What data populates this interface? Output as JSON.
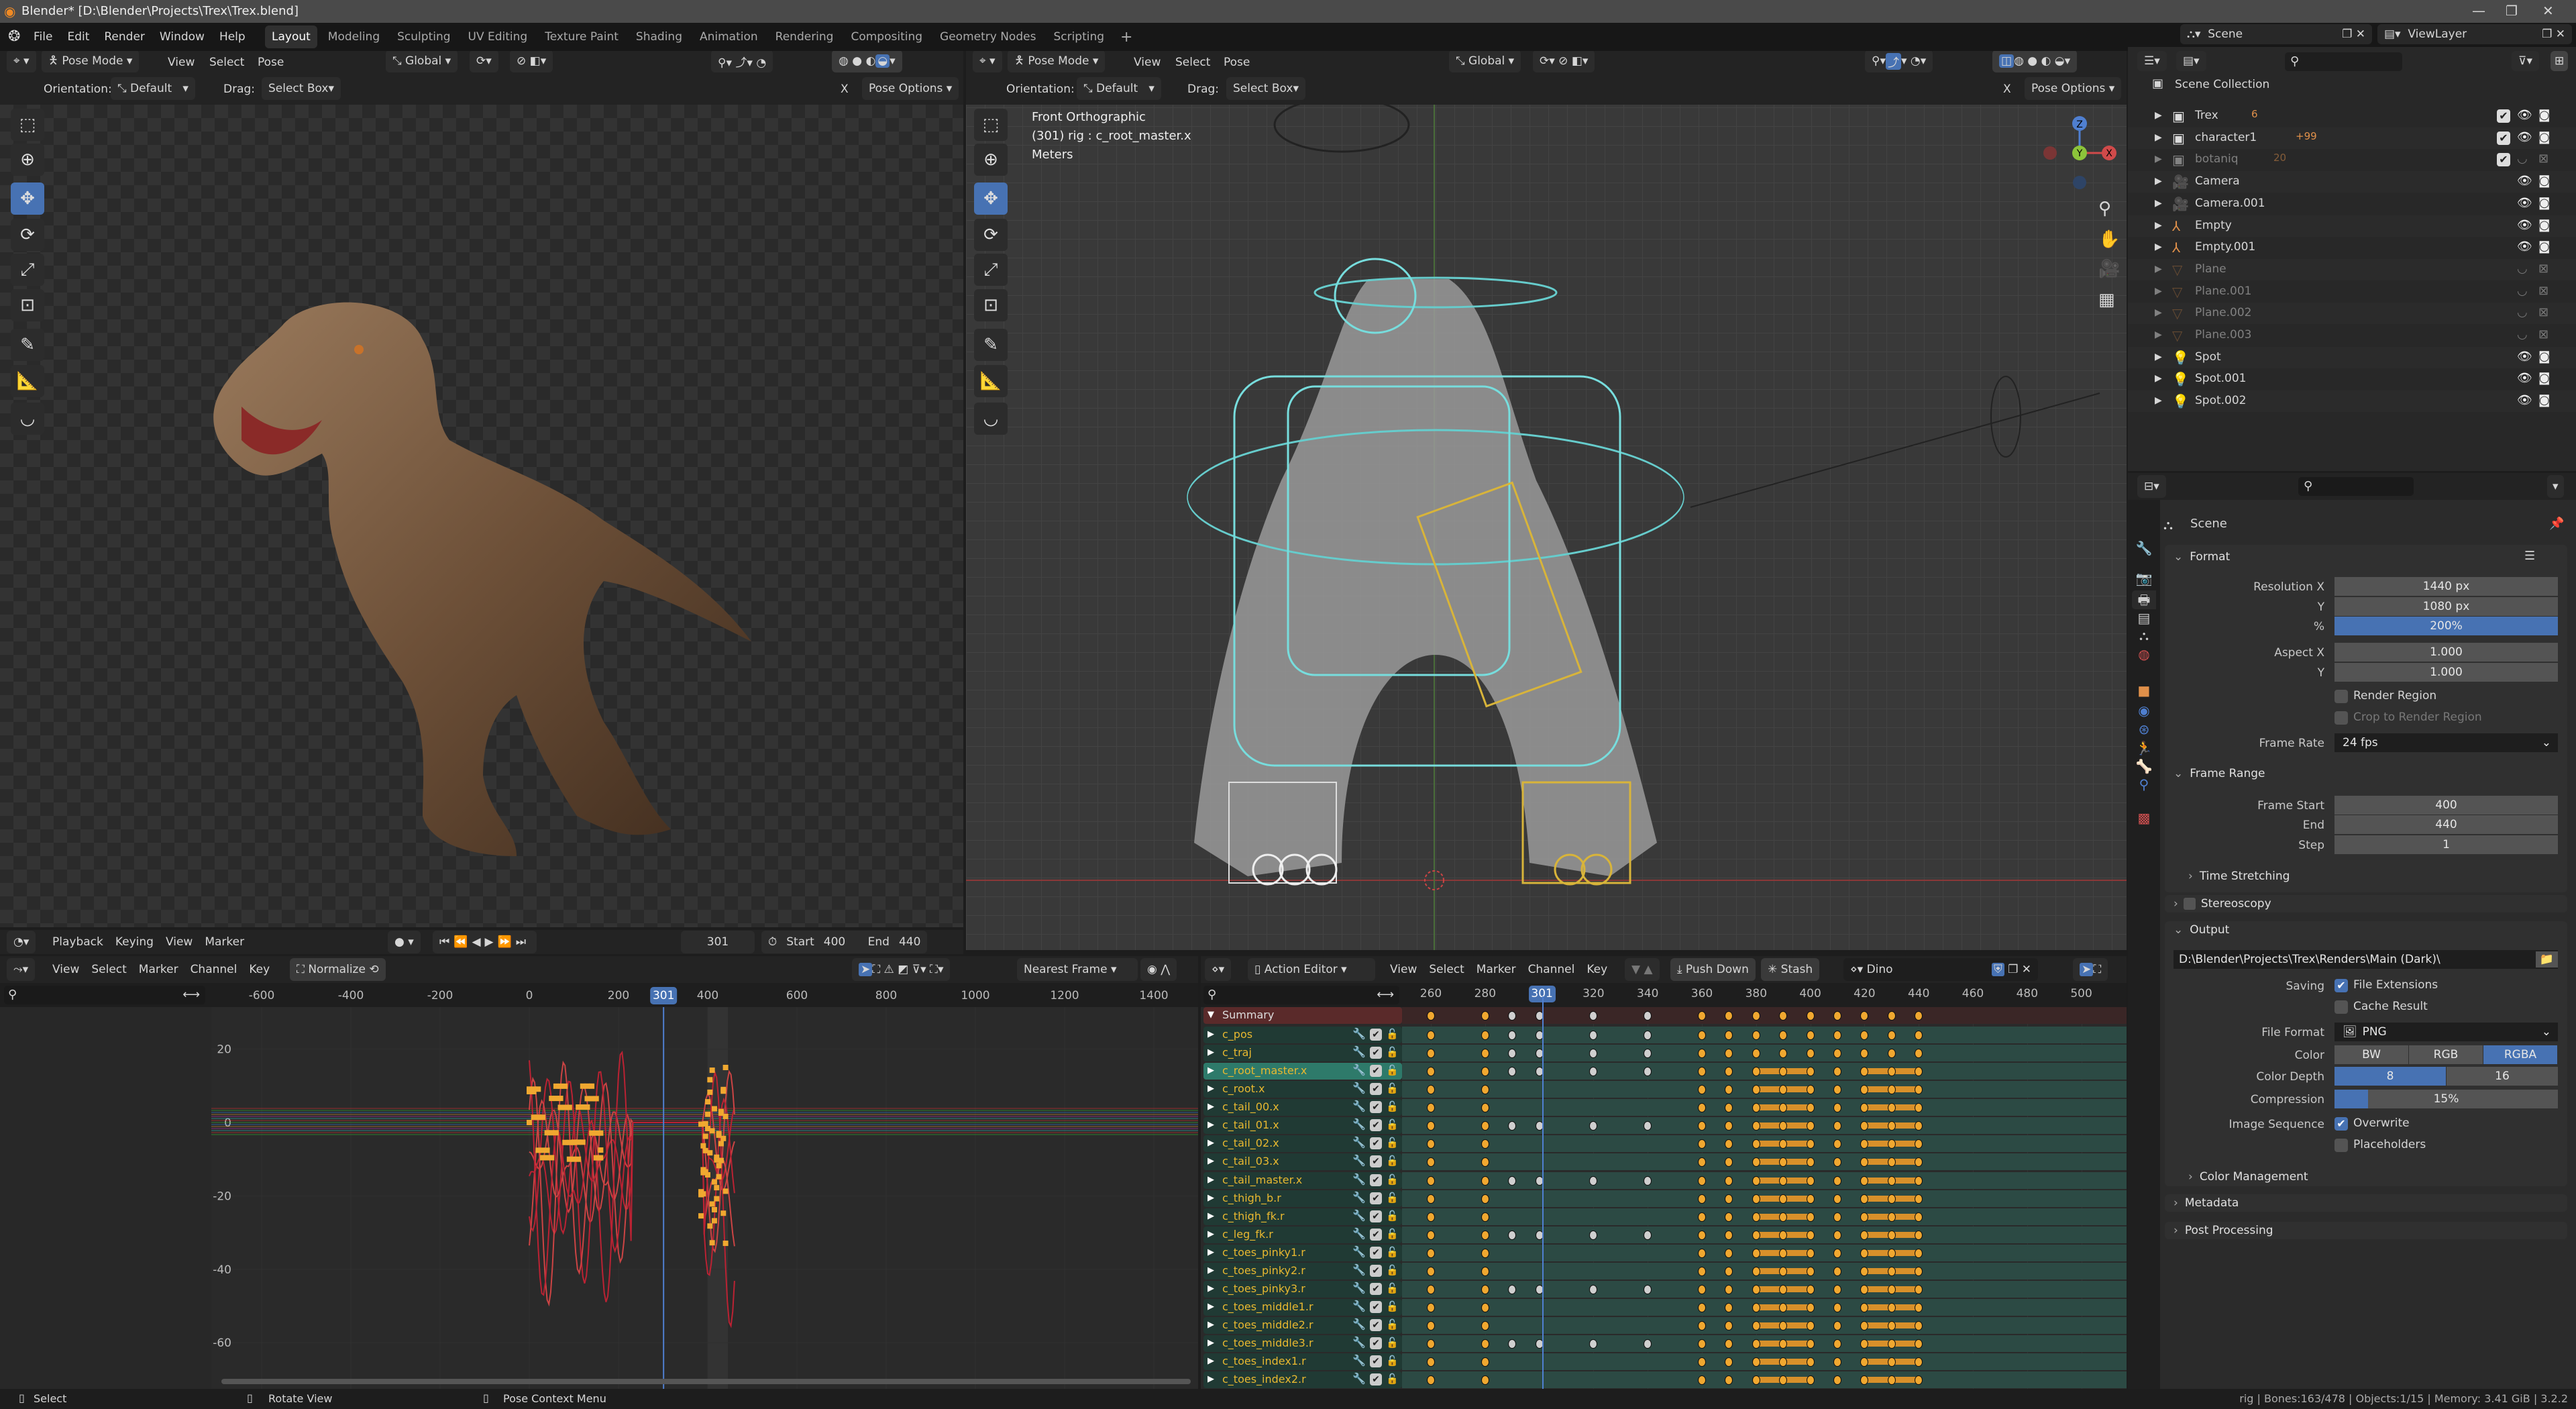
{
  "title_bar": {
    "title": "Blender* [D:\\Blender\\Projects\\Trex\\Trex.blend]"
  },
  "menu": [
    "File",
    "Edit",
    "Render",
    "Window",
    "Help"
  ],
  "workspaces": [
    "Layout",
    "Modeling",
    "Sculpting",
    "UV Editing",
    "Texture Paint",
    "Shading",
    "Animation",
    "Rendering",
    "Compositing",
    "Geometry Nodes",
    "Scripting"
  ],
  "workspace_active": "Layout",
  "viewport_left": {
    "mode": "Pose Mode",
    "menus": [
      "View",
      "Select",
      "Pose"
    ],
    "transform": "Global",
    "orientation_label": "Orientation:",
    "orientation": "Default",
    "drag_label": "Drag:",
    "drag": "Select Box",
    "pose_options": "Pose Options",
    "x_label": "X"
  },
  "viewport_right": {
    "mode": "Pose Mode",
    "menus": [
      "View",
      "Select",
      "Pose"
    ],
    "transform": "Global",
    "orientation_label": "Orientation:",
    "orientation": "Default",
    "drag_label": "Drag:",
    "drag": "Select Box",
    "pose_options": "Pose Options",
    "x_label": "X",
    "overlay": [
      "Front Orthographic",
      "(301) rig : c_root_master.x",
      "Meters"
    ],
    "gizmo": {
      "x": "X",
      "y": "Y",
      "z": "Z"
    }
  },
  "outliner": {
    "scene": "Scene",
    "view_layer": "ViewLayer",
    "root": "Scene Collection",
    "items": [
      {
        "name": "Trex",
        "icon": "collection",
        "badge": "6",
        "check": true,
        "dim": false
      },
      {
        "name": "character1",
        "icon": "collection",
        "badge": "+99",
        "check": true,
        "dim": false
      },
      {
        "name": "botaniq",
        "icon": "collection",
        "badge": "20",
        "check": true,
        "dim": true
      },
      {
        "name": "Camera",
        "icon": "camera",
        "badge": "",
        "check": false,
        "dim": false
      },
      {
        "name": "Camera.001",
        "icon": "camera",
        "badge": "",
        "check": false,
        "dim": false
      },
      {
        "name": "Empty",
        "icon": "empty",
        "badge": "",
        "check": false,
        "dim": false
      },
      {
        "name": "Empty.001",
        "icon": "empty",
        "badge": "",
        "check": false,
        "dim": false
      },
      {
        "name": "Plane",
        "icon": "mesh",
        "badge": "",
        "check": false,
        "dim": true
      },
      {
        "name": "Plane.001",
        "icon": "mesh",
        "badge": "",
        "check": false,
        "dim": true
      },
      {
        "name": "Plane.002",
        "icon": "mesh",
        "badge": "",
        "check": false,
        "dim": true
      },
      {
        "name": "Plane.003",
        "icon": "mesh",
        "badge": "",
        "check": false,
        "dim": true
      },
      {
        "name": "Spot",
        "icon": "light",
        "badge": "",
        "check": false,
        "dim": false
      },
      {
        "name": "Spot.001",
        "icon": "light",
        "badge": "",
        "check": false,
        "dim": false
      },
      {
        "name": "Spot.002",
        "icon": "light",
        "badge": "",
        "check": false,
        "dim": false
      }
    ]
  },
  "properties": {
    "context": "Scene",
    "format": {
      "title": "Format",
      "res_x_label": "Resolution X",
      "res_x": "1440 px",
      "res_y_label": "Y",
      "res_y": "1080 px",
      "pct_label": "%",
      "pct": "200%",
      "aspect_x_label": "Aspect X",
      "aspect_x": "1.000",
      "aspect_y_label": "Y",
      "aspect_y": "1.000",
      "render_region": "Render Region",
      "crop": "Crop to Render Region",
      "frame_rate_label": "Frame Rate",
      "frame_rate": "24 fps"
    },
    "frame_range": {
      "title": "Frame Range",
      "start_label": "Frame Start",
      "start": "400",
      "end_label": "End",
      "end": "440",
      "step_label": "Step",
      "step": "1",
      "time_stretching": "Time Stretching"
    },
    "stereoscopy": "Stereoscopy",
    "output": {
      "title": "Output",
      "path": "D:\\Blender\\Projects\\Trex\\Renders\\Main (Dark)\\",
      "saving_label": "Saving",
      "file_extensions": "File Extensions",
      "cache_result": "Cache Result",
      "file_format_label": "File Format",
      "file_format": "PNG",
      "color_label": "Color",
      "color_options": [
        "BW",
        "RGB",
        "RGBA"
      ],
      "color_selected": "RGBA",
      "depth_label": "Color Depth",
      "depth_options": [
        "8",
        "16"
      ],
      "depth_selected": "8",
      "compression_label": "Compression",
      "compression": "15%",
      "compression_value": 0.15,
      "image_sequence_label": "Image Sequence",
      "overwrite": "Overwrite",
      "placeholders": "Placeholders",
      "color_management": "Color Management"
    },
    "metadata": "Metadata",
    "post_processing": "Post Processing"
  },
  "timeline": {
    "menus": [
      "Playback",
      "Keying",
      "View",
      "Marker"
    ],
    "current_frame": "301",
    "start_label": "Start",
    "start": "400",
    "end_label": "End",
    "end": "440"
  },
  "graph_editor": {
    "menus": [
      "View",
      "Select",
      "Marker",
      "Channel",
      "Key"
    ],
    "normalize": "Normalize",
    "snap": "Nearest Frame",
    "x_ticks": [
      "-600",
      "-400",
      "-200",
      "0",
      "200",
      "301",
      "400",
      "600",
      "800",
      "1000",
      "1200",
      "1400"
    ],
    "y_ticks": [
      "20",
      "0",
      "-20",
      "-40",
      "-60"
    ]
  },
  "action_editor": {
    "mode": "Action Editor",
    "menus": [
      "View",
      "Select",
      "Marker",
      "Channel",
      "Key"
    ],
    "push_down": "Push Down",
    "stash": "Stash",
    "action": "Dino",
    "ticks": [
      "260",
      "280",
      "301",
      "320",
      "340",
      "360",
      "380",
      "400",
      "420",
      "440",
      "460",
      "480",
      "500"
    ],
    "current_frame": 301,
    "summary": "Summary",
    "channels": [
      "c_pos",
      "c_traj",
      "c_root_master.x",
      "c_root.x",
      "c_tail_00.x",
      "c_tail_01.x",
      "c_tail_02.x",
      "c_tail_03.x",
      "c_tail_master.x",
      "c_thigh_b.r",
      "c_thigh_fk.r",
      "c_leg_fk.r",
      "c_toes_pinky1.r",
      "c_toes_pinky2.r",
      "c_toes_pinky3.r",
      "c_toes_middle1.r",
      "c_toes_middle2.r",
      "c_toes_middle3.r",
      "c_toes_index1.r",
      "c_toes_index2.r"
    ],
    "selected_channel": "c_root_master.x",
    "keyframes_selected": [
      260,
      280,
      360,
      370,
      380,
      390,
      400,
      410,
      420,
      430,
      440
    ],
    "keyframes_unselected": [
      290,
      300,
      320,
      340
    ]
  },
  "status_bar": {
    "left": [
      "Select",
      "Rotate View",
      "Pose Context Menu"
    ],
    "right": "rig | Bones:163/478 | Objects:1/15 | Memory: 3.41 GiB | 3.2.2"
  },
  "colors": {
    "accent": "#4772b3",
    "keyframe": "#f0a830",
    "channel_bg": "#203a34",
    "summary_bg": "#5a2a2a"
  }
}
